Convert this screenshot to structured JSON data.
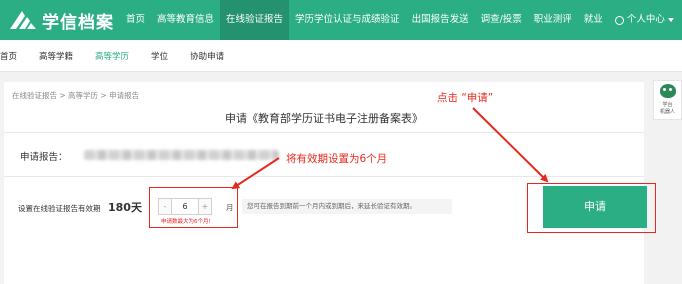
{
  "header": {
    "logo_text": "学信档案",
    "nav": [
      {
        "label": "首页",
        "active": false
      },
      {
        "label": "高等教育信息",
        "active": false
      },
      {
        "label": "在线验证报告",
        "active": true
      },
      {
        "label": "学历学位认证与成绩验证",
        "active": false
      },
      {
        "label": "出国报告发送",
        "active": false
      },
      {
        "label": "调查/投票",
        "active": false
      },
      {
        "label": "职业测评",
        "active": false
      },
      {
        "label": "就业",
        "active": false
      }
    ],
    "user_menu_label": "个人中心",
    "brand_color": "#2cae85"
  },
  "subnav": {
    "items": [
      {
        "label": "首页",
        "active": false
      },
      {
        "label": "高等学籍",
        "active": false
      },
      {
        "label": "高等学历",
        "active": true
      },
      {
        "label": "学位",
        "active": false
      },
      {
        "label": "协助申请",
        "active": false
      }
    ]
  },
  "main": {
    "breadcrumb": "在线验证报告 > 高等学历 > 申请报告",
    "title": "申请《教育部学历证书电子注册备案表》",
    "report_label": "申请报告：",
    "validity_label": "设置在线验证报告有效期",
    "validity_days": "180天",
    "stepper": {
      "minus": "-",
      "value": "6",
      "plus": "+"
    },
    "unit": "月",
    "max_hint": "申请数最大为6个月!",
    "tip": "您可在报告到期前一个月内或到期后，来延长验证有效期。",
    "apply_button": "申请"
  },
  "float_widget": {
    "label_line1": "学台",
    "label_line2": "机器人"
  },
  "annotations": {
    "click_apply": "点击 “申请”",
    "set_validity": "将有效期设置为6个月",
    "color": "#e8281e"
  }
}
